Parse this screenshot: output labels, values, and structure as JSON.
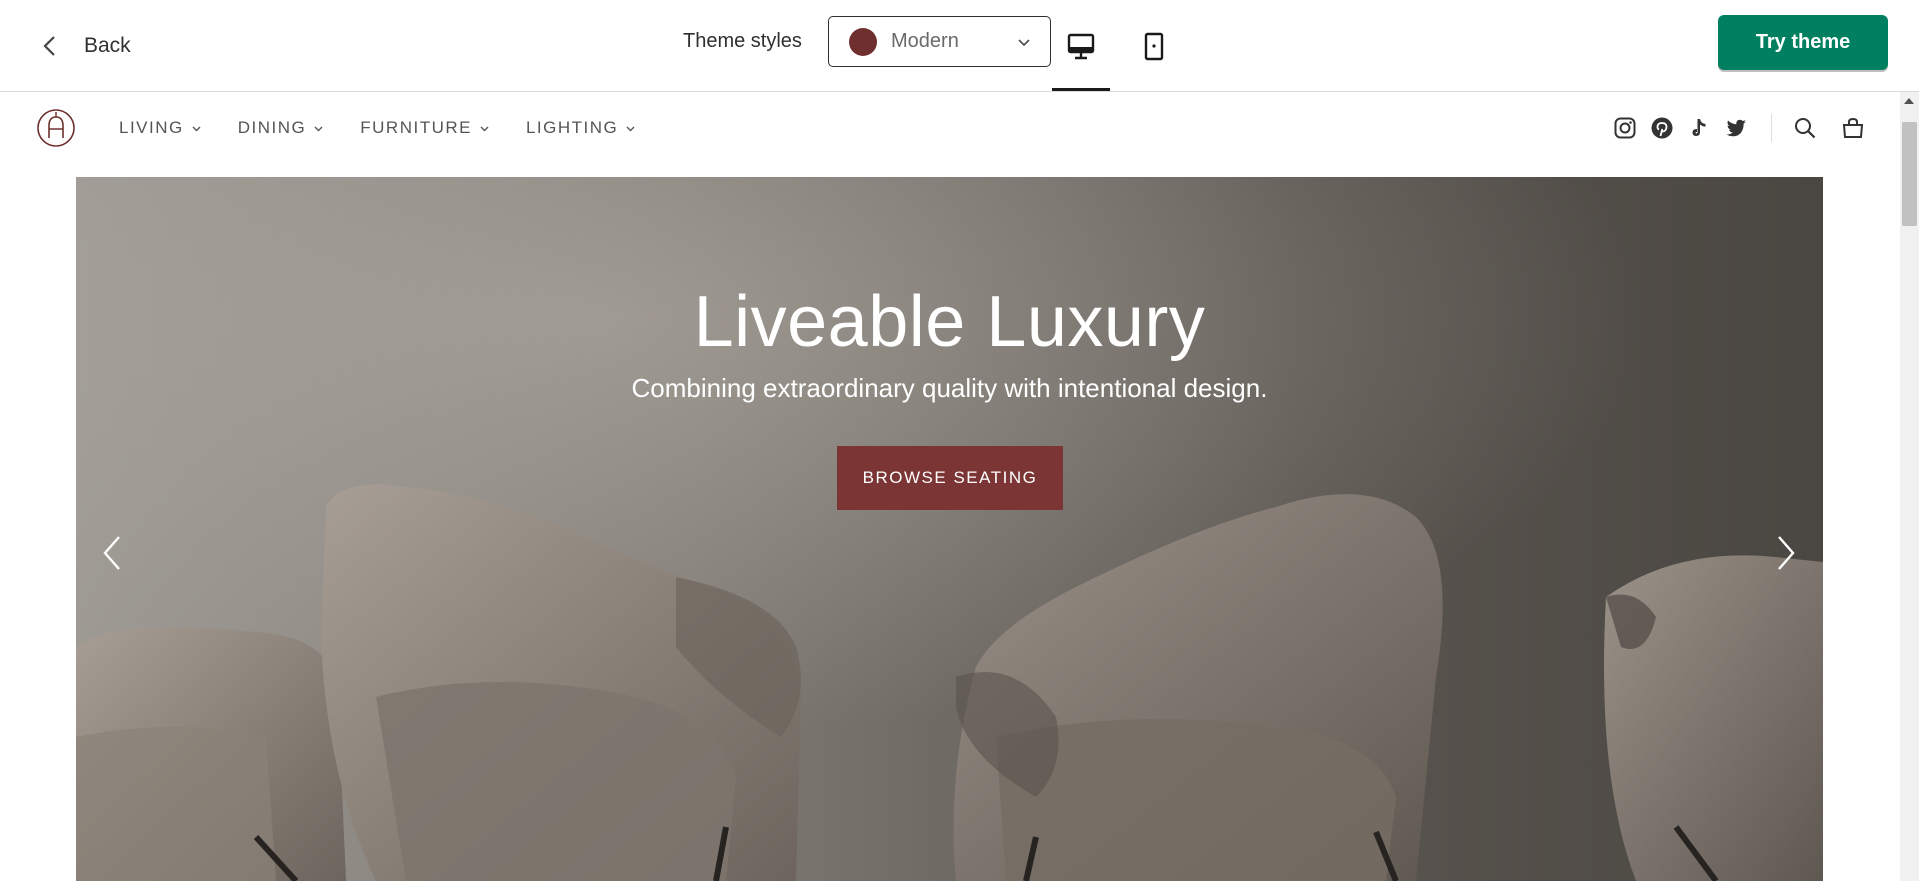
{
  "topbar": {
    "back_label": "Back",
    "theme_styles_label": "Theme styles",
    "style_select": {
      "value": "Modern",
      "swatch_color": "#6e2f2e"
    },
    "devices": [
      "desktop-icon",
      "mobile-icon"
    ],
    "active_device": "desktop",
    "try_theme_label": "Try theme",
    "try_theme_color": "#008060"
  },
  "store": {
    "logo_letter": "A",
    "nav": {
      "items": [
        {
          "label": "LIVING"
        },
        {
          "label": "DINING"
        },
        {
          "label": "FURNITURE"
        },
        {
          "label": "LIGHTING"
        }
      ],
      "social_icons": [
        "instagram-icon",
        "pinterest-icon",
        "tiktok-icon",
        "twitter-icon"
      ],
      "utility_icons": [
        "search-icon",
        "cart-icon"
      ]
    },
    "hero": {
      "title": "Liveable Luxury",
      "subtitle": "Combining extraordinary quality with intentional design.",
      "cta_label": "BROWSE SEATING",
      "cta_color": "#7b3534"
    }
  }
}
